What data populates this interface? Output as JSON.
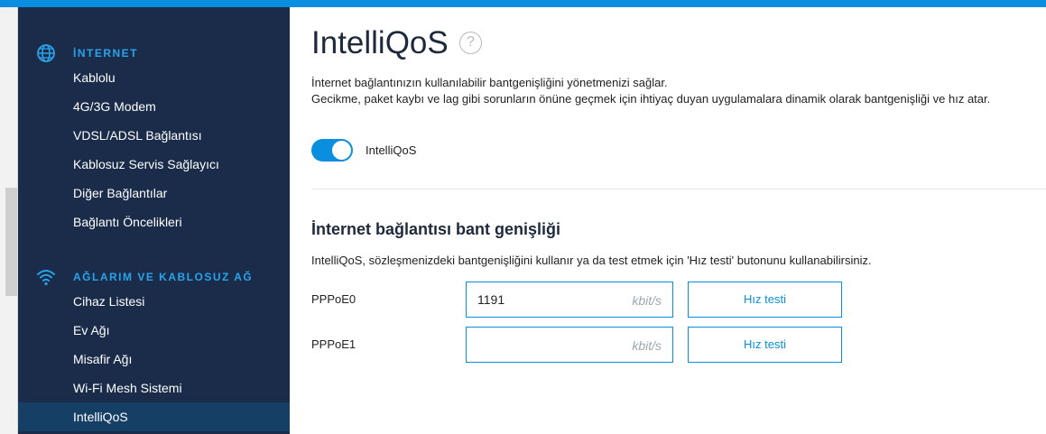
{
  "sidebar": {
    "sections": [
      {
        "title": "İNTERNET",
        "icon": "globe-icon",
        "items": [
          {
            "label": "Kablolu"
          },
          {
            "label": "4G/3G Modem"
          },
          {
            "label": "VDSL/ADSL Bağlantısı"
          },
          {
            "label": "Kablosuz Servis Sağlayıcı"
          },
          {
            "label": "Diğer Bağlantılar"
          },
          {
            "label": "Bağlantı Öncelikleri"
          }
        ]
      },
      {
        "title": "AĞLARIM VE KABLOSUZ AĞ",
        "icon": "wifi-icon",
        "items": [
          {
            "label": "Cihaz Listesi"
          },
          {
            "label": "Ev Ağı"
          },
          {
            "label": "Misafir Ağı"
          },
          {
            "label": "Wi-Fi Mesh Sistemi"
          },
          {
            "label": "IntelliQoS",
            "active": true
          }
        ]
      }
    ]
  },
  "main": {
    "title": "IntelliQoS",
    "help_symbol": "?",
    "description_line1": "İnternet bağlantınızın kullanılabilir bantgenişliğini yönetmenizi sağlar.",
    "description_line2": "Gecikme, paket kaybı ve lag gibi sorunların önüne geçmek için ihtiyaç duyan uygulamalara dinamik olarak bantgenişliği ve hız atar.",
    "toggle": {
      "label": "IntelliQoS",
      "enabled": true
    },
    "bandwidth_section": {
      "heading": "İnternet bağlantısı bant genişliği",
      "description": "IntelliQoS, sözleşmenizdeki bantgenişliğini kullanır ya da test etmek için 'Hız testi' butonunu kullanabilirsiniz.",
      "rows": [
        {
          "label": "PPPoE0",
          "value": "1191",
          "unit": "kbit/s",
          "button": "Hız testi"
        },
        {
          "label": "PPPoE1",
          "value": "",
          "unit": "kbit/s",
          "button": "Hız testi"
        }
      ]
    }
  },
  "colors": {
    "accent": "#0a8fe0",
    "sidebar_bg": "#1a2c4a",
    "sidebar_active": "#163f66",
    "section_title": "#2aa3e8"
  }
}
